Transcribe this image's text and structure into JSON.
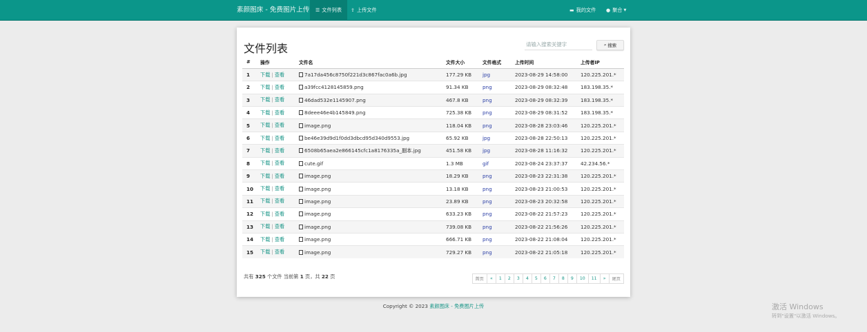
{
  "nav": {
    "brand": "素颜图床 - 免费图片上传",
    "file_list": "文件列表",
    "upload": "上传文件",
    "my_files": "我的文件",
    "user": "聚合"
  },
  "page": {
    "title": "文件列表",
    "search_placeholder": "请输入搜索关键字",
    "search_button": "搜索"
  },
  "table": {
    "headers": [
      "#",
      "操作",
      "文件名",
      "文件大小",
      "文件格式",
      "上传时间",
      "上传者IP"
    ],
    "download_label": "下载",
    "view_label": "查看",
    "rows": [
      {
        "id": "1",
        "name": "7a17da456c8750f221d3c867fac0a6b.jpg",
        "size": "177.29 KB",
        "format": "jpg",
        "time": "2023-08-29 14:58:00",
        "ip": "120.225.201.*"
      },
      {
        "id": "2",
        "name": "a39fcc4128145859.png",
        "size": "91.34 KB",
        "format": "png",
        "time": "2023-08-29 08:32:48",
        "ip": "183.198.35.*"
      },
      {
        "id": "3",
        "name": "46dad532e1145907.png",
        "size": "467.8 KB",
        "format": "png",
        "time": "2023-08-29 08:32:39",
        "ip": "183.198.35.*"
      },
      {
        "id": "4",
        "name": "8deee46e4b145849.png",
        "size": "725.38 KB",
        "format": "png",
        "time": "2023-08-29 08:31:52",
        "ip": "183.198.35.*"
      },
      {
        "id": "5",
        "name": "image.png",
        "size": "118.04 KB",
        "format": "png",
        "time": "2023-08-28 23:03:46",
        "ip": "120.225.201.*"
      },
      {
        "id": "6",
        "name": "be46e39d9d1f0dd3dbcd95d340d9553.jpg",
        "size": "65.92 KB",
        "format": "jpg",
        "time": "2023-08-28 22:50:13",
        "ip": "120.225.201.*"
      },
      {
        "id": "7",
        "name": "6508b65aea2e866145cfc1a8176335a_副本.jpg",
        "size": "451.58 KB",
        "format": "jpg",
        "time": "2023-08-28 11:16:32",
        "ip": "120.225.201.*"
      },
      {
        "id": "8",
        "name": "cute.gif",
        "size": "1.3 MB",
        "format": "gif",
        "time": "2023-08-24 23:37:37",
        "ip": "42.234.56.*"
      },
      {
        "id": "9",
        "name": "image.png",
        "size": "18.29 KB",
        "format": "png",
        "time": "2023-08-23 22:31:38",
        "ip": "120.225.201.*"
      },
      {
        "id": "10",
        "name": "image.png",
        "size": "13.18 KB",
        "format": "png",
        "time": "2023-08-23 21:00:53",
        "ip": "120.225.201.*"
      },
      {
        "id": "11",
        "name": "image.png",
        "size": "23.89 KB",
        "format": "png",
        "time": "2023-08-23 20:32:58",
        "ip": "120.225.201.*"
      },
      {
        "id": "12",
        "name": "image.png",
        "size": "633.23 KB",
        "format": "png",
        "time": "2023-08-22 21:57:23",
        "ip": "120.225.201.*"
      },
      {
        "id": "13",
        "name": "image.png",
        "size": "739.08 KB",
        "format": "png",
        "time": "2023-08-22 21:56:26",
        "ip": "120.225.201.*"
      },
      {
        "id": "14",
        "name": "image.png",
        "size": "666.71 KB",
        "format": "png",
        "time": "2023-08-22 21:08:04",
        "ip": "120.225.201.*"
      },
      {
        "id": "15",
        "name": "image.png",
        "size": "729.27 KB",
        "format": "png",
        "time": "2023-08-22 21:05:18",
        "ip": "120.225.201.*"
      }
    ]
  },
  "summary": {
    "prefix": "共有",
    "total": "325",
    "files_current": "个文件  当前第",
    "current_page": "1",
    "page_total": "页，共",
    "total_pages": "22",
    "page_suffix": "页"
  },
  "pagination": {
    "first": "首页",
    "prev": "«",
    "pages": [
      "1",
      "2",
      "3",
      "4",
      "5",
      "6",
      "7",
      "8",
      "9",
      "10",
      "11"
    ],
    "next": "»",
    "last": "尾页"
  },
  "footer": {
    "copyright": "Copyright © 2023",
    "link": "素颜图床 - 免费图片上传"
  },
  "watermark": {
    "line1": "激活 Windows",
    "line2": "转到\"设置\"以激活 Windows。"
  }
}
